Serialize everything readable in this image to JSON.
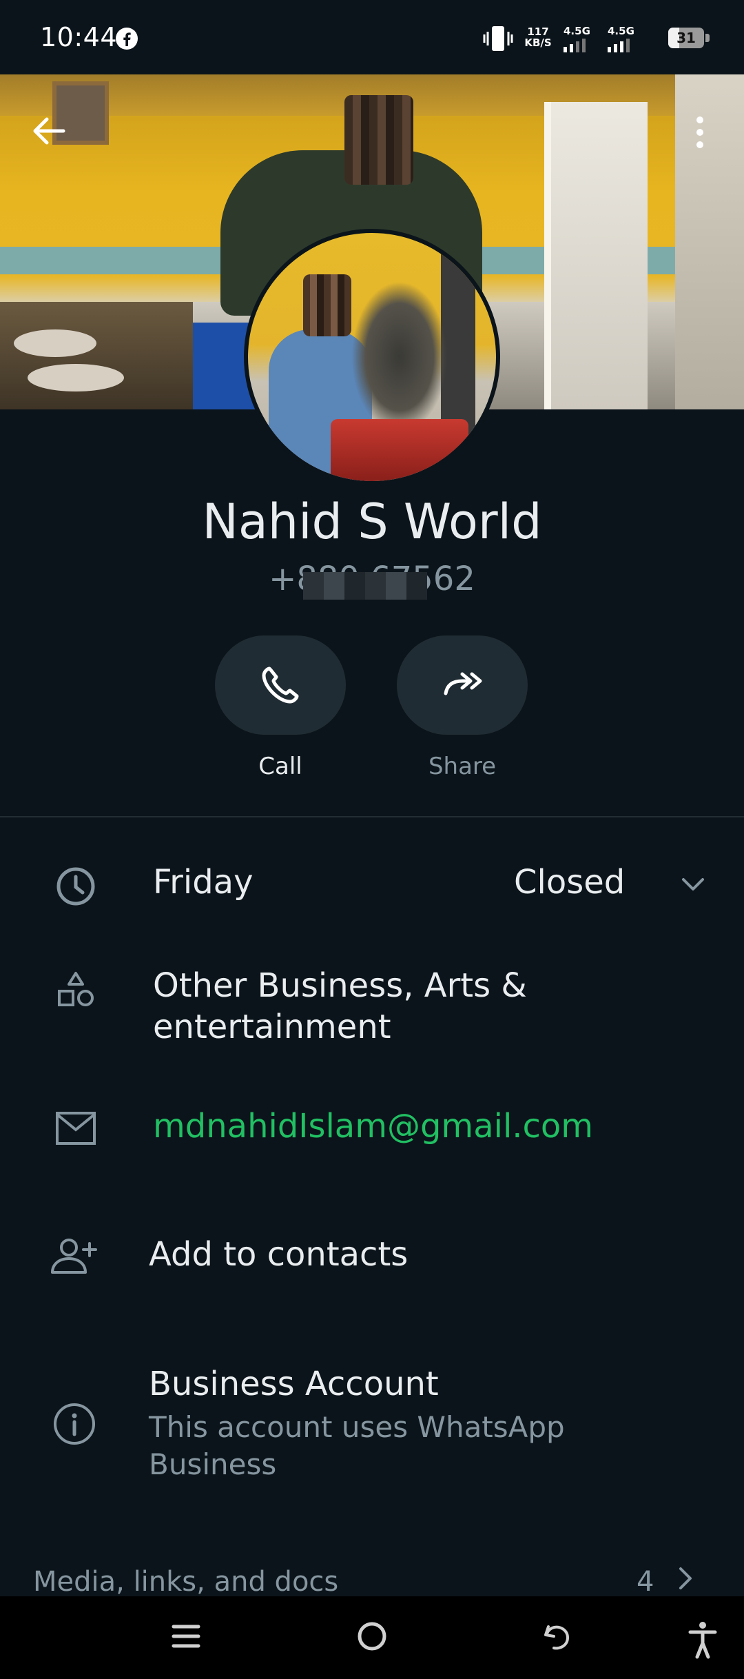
{
  "status_bar": {
    "time": "10:44",
    "net_speed_value": "117",
    "net_speed_unit": "KB/S",
    "network_1": "4.5G",
    "network_2": "4.5G",
    "battery_level": "31",
    "battery_fraction": 0.31
  },
  "profile": {
    "name": "Nahid S World",
    "phone": "+880         67562"
  },
  "actions": [
    {
      "label": "Call",
      "icon": "phone-icon"
    },
    {
      "label": "Share",
      "icon": "share-forward-icon"
    }
  ],
  "hours": {
    "day": "Friday",
    "status": "Closed"
  },
  "category": {
    "line1": "Other Business, Arts &",
    "line2": "entertainment"
  },
  "email": "mdnahidIslam@gmail.com",
  "add_contact": "Add to contacts",
  "business_account": {
    "title": "Business Account",
    "subtitle_line1": "This account uses WhatsApp",
    "subtitle_line2": "Business"
  },
  "media": {
    "label": "Media, links, and docs",
    "count": "4"
  },
  "colors": {
    "background": "#0b141a",
    "accent_green": "#21c063",
    "secondary_text": "#8696a0",
    "button_bg": "#202c33"
  }
}
